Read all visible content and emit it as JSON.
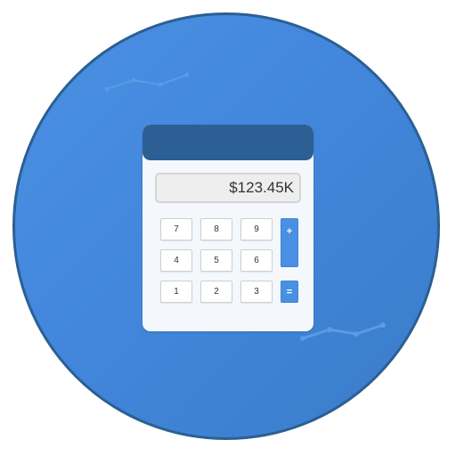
{
  "display": {
    "value": "$123.45K"
  },
  "keypad": {
    "rows": [
      [
        "7",
        "8",
        "9"
      ],
      [
        "4",
        "5",
        "6"
      ],
      [
        "1",
        "2",
        "3"
      ]
    ],
    "operators": {
      "plus": "+",
      "equals": "="
    }
  },
  "colors": {
    "circle_fill": "#4a90e2",
    "circle_border": "#2c5f93",
    "header": "#2c5f93",
    "operator_key": "#4a90e2",
    "calculator_body": "#f4f7fb",
    "display_bg": "#eeeeee"
  },
  "icons": {
    "decoration": "trend-line-icon"
  }
}
